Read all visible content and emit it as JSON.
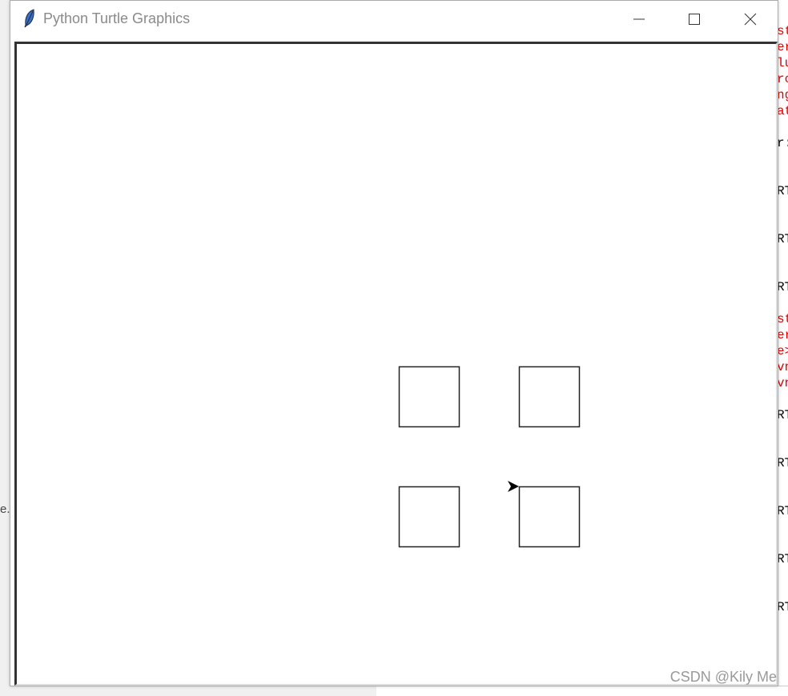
{
  "window": {
    "title": "Python Turtle Graphics",
    "icon": "feather-icon"
  },
  "controls": {
    "minimize": "minimize-icon",
    "maximize": "maximize-icon",
    "close": "close-icon"
  },
  "canvas": {
    "line_color": "#222222",
    "squares": [
      {
        "label": "top-left"
      },
      {
        "label": "top-right"
      },
      {
        "label": "bottom-left"
      },
      {
        "label": "bottom-right"
      }
    ],
    "turtle_heading": "east"
  },
  "background": {
    "left_text": "e.",
    "right_fragments": [
      {
        "text": "st",
        "color": "#e00000"
      },
      {
        "text": "er",
        "color": "#e00000"
      },
      {
        "text": "lu",
        "color": "#e00000"
      },
      {
        "text": "rc",
        "color": "#e00000"
      },
      {
        "text": "ng",
        "color": "#e00000"
      },
      {
        "text": "at",
        "color": "#e00000"
      },
      {
        "text": "r:",
        "color": "#000000"
      },
      {
        "text": "RT",
        "color": "#000000"
      },
      {
        "text": "RT",
        "color": "#000000"
      },
      {
        "text": "RT",
        "color": "#000000"
      },
      {
        "text": "st",
        "color": "#e00000"
      },
      {
        "text": "er",
        "color": "#e00000"
      },
      {
        "text": "e>",
        "color": "#e00000"
      },
      {
        "text": "vn",
        "color": "#e00000"
      },
      {
        "text": "vn",
        "color": "#e00000"
      },
      {
        "text": "RT",
        "color": "#000000"
      },
      {
        "text": "RT",
        "color": "#000000"
      },
      {
        "text": "RT",
        "color": "#000000"
      },
      {
        "text": "RT",
        "color": "#000000"
      },
      {
        "text": "RT",
        "color": "#000000"
      }
    ]
  },
  "watermark": "CSDN @Kily Me"
}
